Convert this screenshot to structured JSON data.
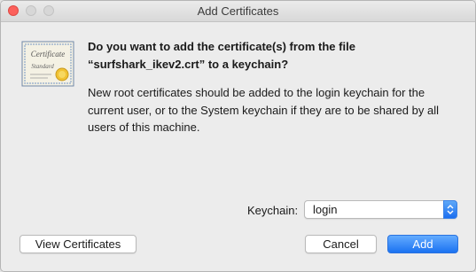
{
  "window": {
    "title": "Add Certificates"
  },
  "icon": {
    "name": "certificate-icon",
    "lettering": [
      "Certificate",
      "Standard"
    ]
  },
  "message": {
    "heading_line1": "Do you want to add the certificate(s) from the file",
    "heading_line2": "“surfshark_ikev2.crt” to a keychain?",
    "body_line1": "New root certificates should be added to the login keychain for the",
    "body_line2": "current user, or to the System keychain if they are to be shared by all",
    "body_line3": "users of this machine."
  },
  "keychain": {
    "label": "Keychain:",
    "selected": "login"
  },
  "buttons": {
    "view_certificates": "View Certificates",
    "cancel": "Cancel",
    "add": "Add"
  },
  "colors": {
    "accent": "#1b72f1",
    "close_button": "#fc605b",
    "window_bg": "#ececec"
  }
}
